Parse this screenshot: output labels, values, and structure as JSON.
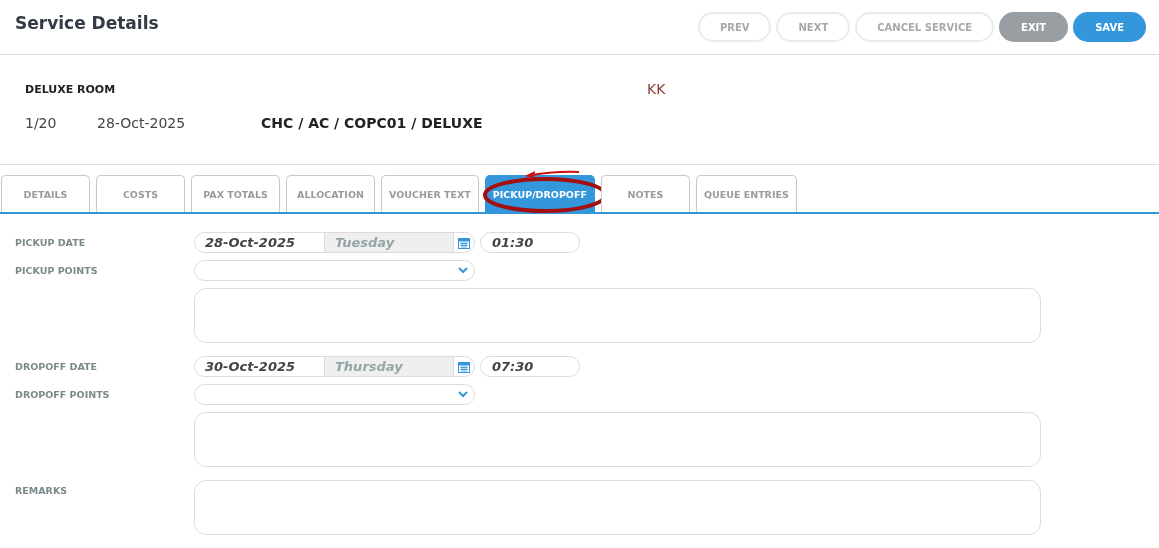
{
  "title": "Service Details",
  "buttons": [
    {
      "label": "PREV",
      "kind": "outline"
    },
    {
      "label": "NEXT",
      "kind": "outline"
    },
    {
      "label": "CANCEL SERVICE",
      "kind": "outline"
    },
    {
      "label": "EXIT",
      "kind": "grey"
    },
    {
      "label": "SAVE",
      "kind": "primary"
    }
  ],
  "service": {
    "name": "DELUXE ROOM",
    "code": "KK",
    "number": "1/20",
    "date": "28-Oct-2025",
    "path": "CHC / AC / COPC01 / DELUXE"
  },
  "tabs": [
    {
      "label": "DETAILS",
      "selected": false
    },
    {
      "label": "COSTS",
      "selected": false
    },
    {
      "label": "PAX TOTALS",
      "selected": false
    },
    {
      "label": "ALLOCATION",
      "selected": false
    },
    {
      "label": "VOUCHER TEXT",
      "selected": false
    },
    {
      "label": "PICKUP/DROPOFF",
      "selected": true,
      "annotated": true
    },
    {
      "label": "NOTES",
      "selected": false
    },
    {
      "label": "QUEUE ENTRIES",
      "selected": false
    }
  ],
  "sections": [
    {
      "date_label": "PICKUP DATE",
      "date": "28-Oct-2025",
      "day": "Tuesday",
      "time": "01:30",
      "points_label": "PICKUP POINTS"
    },
    {
      "date_label": "DROPOFF DATE",
      "date": "30-Oct-2025",
      "day": "Thursday",
      "time": "07:30",
      "points_label": "DROPOFF POINTS"
    }
  ],
  "remarks_label": "REMARKS"
}
